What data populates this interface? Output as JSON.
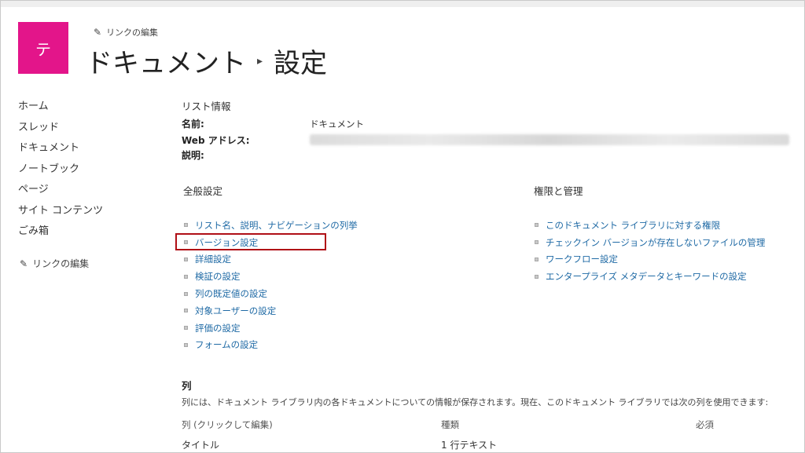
{
  "site": {
    "logo_letter": "テ",
    "edit_links_label": "リンクの編集"
  },
  "page": {
    "title_main": "ドキュメント",
    "title_separator": "▸",
    "title_sub": "設定"
  },
  "nav": {
    "items": [
      {
        "label": "ホーム"
      },
      {
        "label": "スレッド"
      },
      {
        "label": "ドキュメント"
      },
      {
        "label": "ノートブック"
      },
      {
        "label": "ページ"
      },
      {
        "label": "サイト コンテンツ"
      },
      {
        "label": "ごみ箱"
      }
    ],
    "edit_links_label": "リンクの編集"
  },
  "list_info": {
    "heading": "リスト情報",
    "name_label": "名前:",
    "name_value": "ドキュメント",
    "web_address_label": "Web アドレス:",
    "description_label": "説明:"
  },
  "general_settings": {
    "heading": "全般設定",
    "links": [
      {
        "label": "リスト名、説明、ナビゲーションの列挙"
      },
      {
        "label": "バージョン設定"
      },
      {
        "label": "詳細設定"
      },
      {
        "label": "検証の設定"
      },
      {
        "label": "列の既定値の設定"
      },
      {
        "label": "対象ユーザーの設定"
      },
      {
        "label": "評価の設定"
      },
      {
        "label": "フォームの設定"
      }
    ]
  },
  "permissions": {
    "heading": "権限と管理",
    "links": [
      {
        "label": "このドキュメント ライブラリに対する権限"
      },
      {
        "label": "チェックイン バージョンが存在しないファイルの管理"
      },
      {
        "label": "ワークフロー設定"
      },
      {
        "label": "エンタープライズ メタデータとキーワードの設定"
      }
    ]
  },
  "columns": {
    "heading": "列",
    "description": "列には、ドキュメント ライブラリ内の各ドキュメントについての情報が保存されます。現在、このドキュメント ライブラリでは次の列を使用できます:",
    "header_column": "列 (クリックして編集)",
    "header_type": "種類",
    "header_required": "必須",
    "rows": [
      {
        "name": "タイトル",
        "type": "1 行テキスト",
        "required": ""
      }
    ]
  },
  "colors": {
    "logo_bg": "#e3158a",
    "link": "#1f6aa5",
    "highlight": "#b00f16"
  }
}
